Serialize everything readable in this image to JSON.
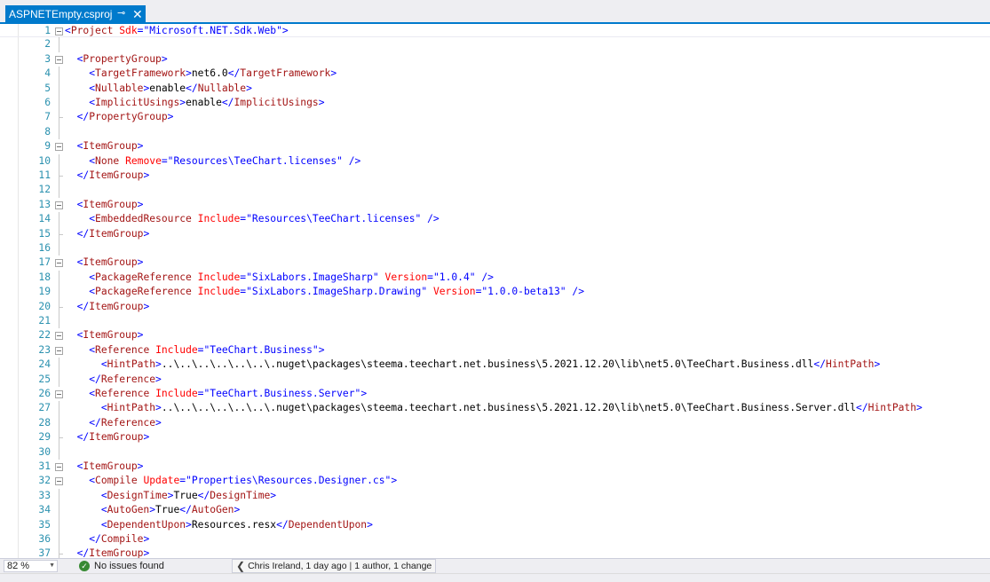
{
  "tab": {
    "title": "ASPNETEmpty.csproj",
    "pin_glyph": "⊸",
    "close_glyph": "✕"
  },
  "editor": {
    "lines": [
      {
        "n": "1",
        "tokens": [
          [
            "d",
            "<"
          ],
          [
            "e",
            "Project"
          ],
          [
            "x",
            " "
          ],
          [
            "a",
            "Sdk"
          ],
          [
            "d",
            "=\""
          ],
          [
            "v",
            "Microsoft.NET.Sdk.Web"
          ],
          [
            "d",
            "\">"
          ]
        ]
      },
      {
        "n": "2",
        "tokens": []
      },
      {
        "n": "3",
        "tokens": [
          [
            "x",
            "  "
          ],
          [
            "d",
            "<"
          ],
          [
            "e",
            "PropertyGroup"
          ],
          [
            "d",
            ">"
          ]
        ]
      },
      {
        "n": "4",
        "tokens": [
          [
            "x",
            "    "
          ],
          [
            "d",
            "<"
          ],
          [
            "e",
            "TargetFramework"
          ],
          [
            "d",
            ">"
          ],
          [
            "x",
            "net6.0"
          ],
          [
            "d",
            "</"
          ],
          [
            "e",
            "TargetFramework"
          ],
          [
            "d",
            ">"
          ]
        ]
      },
      {
        "n": "5",
        "tokens": [
          [
            "x",
            "    "
          ],
          [
            "d",
            "<"
          ],
          [
            "e",
            "Nullable"
          ],
          [
            "d",
            ">"
          ],
          [
            "x",
            "enable"
          ],
          [
            "d",
            "</"
          ],
          [
            "e",
            "Nullable"
          ],
          [
            "d",
            ">"
          ]
        ]
      },
      {
        "n": "6",
        "tokens": [
          [
            "x",
            "    "
          ],
          [
            "d",
            "<"
          ],
          [
            "e",
            "ImplicitUsings"
          ],
          [
            "d",
            ">"
          ],
          [
            "x",
            "enable"
          ],
          [
            "d",
            "</"
          ],
          [
            "e",
            "ImplicitUsings"
          ],
          [
            "d",
            ">"
          ]
        ]
      },
      {
        "n": "7",
        "tokens": [
          [
            "x",
            "  "
          ],
          [
            "d",
            "</"
          ],
          [
            "e",
            "PropertyGroup"
          ],
          [
            "d",
            ">"
          ]
        ]
      },
      {
        "n": "8",
        "tokens": []
      },
      {
        "n": "9",
        "tokens": [
          [
            "x",
            "  "
          ],
          [
            "d",
            "<"
          ],
          [
            "e",
            "ItemGroup"
          ],
          [
            "d",
            ">"
          ]
        ]
      },
      {
        "n": "10",
        "tokens": [
          [
            "x",
            "    "
          ],
          [
            "d",
            "<"
          ],
          [
            "e",
            "None"
          ],
          [
            "x",
            " "
          ],
          [
            "a",
            "Remove"
          ],
          [
            "d",
            "=\""
          ],
          [
            "v",
            "Resources\\TeeChart.licenses"
          ],
          [
            "d",
            "\" />"
          ]
        ]
      },
      {
        "n": "11",
        "tokens": [
          [
            "x",
            "  "
          ],
          [
            "d",
            "</"
          ],
          [
            "e",
            "ItemGroup"
          ],
          [
            "d",
            ">"
          ]
        ]
      },
      {
        "n": "12",
        "tokens": []
      },
      {
        "n": "13",
        "tokens": [
          [
            "x",
            "  "
          ],
          [
            "d",
            "<"
          ],
          [
            "e",
            "ItemGroup"
          ],
          [
            "d",
            ">"
          ]
        ]
      },
      {
        "n": "14",
        "tokens": [
          [
            "x",
            "    "
          ],
          [
            "d",
            "<"
          ],
          [
            "e",
            "EmbeddedResource"
          ],
          [
            "x",
            " "
          ],
          [
            "a",
            "Include"
          ],
          [
            "d",
            "=\""
          ],
          [
            "v",
            "Resources\\TeeChart.licenses"
          ],
          [
            "d",
            "\" />"
          ]
        ]
      },
      {
        "n": "15",
        "tokens": [
          [
            "x",
            "  "
          ],
          [
            "d",
            "</"
          ],
          [
            "e",
            "ItemGroup"
          ],
          [
            "d",
            ">"
          ]
        ]
      },
      {
        "n": "16",
        "tokens": []
      },
      {
        "n": "17",
        "tokens": [
          [
            "x",
            "  "
          ],
          [
            "d",
            "<"
          ],
          [
            "e",
            "ItemGroup"
          ],
          [
            "d",
            ">"
          ]
        ]
      },
      {
        "n": "18",
        "tokens": [
          [
            "x",
            "    "
          ],
          [
            "d",
            "<"
          ],
          [
            "e",
            "PackageReference"
          ],
          [
            "x",
            " "
          ],
          [
            "a",
            "Include"
          ],
          [
            "d",
            "=\""
          ],
          [
            "v",
            "SixLabors.ImageSharp"
          ],
          [
            "d",
            "\""
          ],
          [
            "x",
            " "
          ],
          [
            "a",
            "Version"
          ],
          [
            "d",
            "=\""
          ],
          [
            "v",
            "1.0.4"
          ],
          [
            "d",
            "\" />"
          ]
        ]
      },
      {
        "n": "19",
        "tokens": [
          [
            "x",
            "    "
          ],
          [
            "d",
            "<"
          ],
          [
            "e",
            "PackageReference"
          ],
          [
            "x",
            " "
          ],
          [
            "a",
            "Include"
          ],
          [
            "d",
            "=\""
          ],
          [
            "v",
            "SixLabors.ImageSharp.Drawing"
          ],
          [
            "d",
            "\""
          ],
          [
            "x",
            " "
          ],
          [
            "a",
            "Version"
          ],
          [
            "d",
            "=\""
          ],
          [
            "v",
            "1.0.0-beta13"
          ],
          [
            "d",
            "\" />"
          ]
        ]
      },
      {
        "n": "20",
        "tokens": [
          [
            "x",
            "  "
          ],
          [
            "d",
            "</"
          ],
          [
            "e",
            "ItemGroup"
          ],
          [
            "d",
            ">"
          ]
        ]
      },
      {
        "n": "21",
        "tokens": []
      },
      {
        "n": "22",
        "tokens": [
          [
            "x",
            "  "
          ],
          [
            "d",
            "<"
          ],
          [
            "e",
            "ItemGroup"
          ],
          [
            "d",
            ">"
          ]
        ]
      },
      {
        "n": "23",
        "tokens": [
          [
            "x",
            "    "
          ],
          [
            "d",
            "<"
          ],
          [
            "e",
            "Reference"
          ],
          [
            "x",
            " "
          ],
          [
            "a",
            "Include"
          ],
          [
            "d",
            "=\""
          ],
          [
            "v",
            "TeeChart.Business"
          ],
          [
            "d",
            "\">"
          ]
        ]
      },
      {
        "n": "24",
        "tokens": [
          [
            "x",
            "      "
          ],
          [
            "d",
            "<"
          ],
          [
            "e",
            "HintPath"
          ],
          [
            "d",
            ">"
          ],
          [
            "x",
            "..\\..\\..\\..\\..\\..\\.nuget\\packages\\steema.teechart.net.business\\5.2021.12.20\\lib\\net5.0\\TeeChart.Business.dll"
          ],
          [
            "d",
            "</"
          ],
          [
            "e",
            "HintPath"
          ],
          [
            "d",
            ">"
          ]
        ]
      },
      {
        "n": "25",
        "tokens": [
          [
            "x",
            "    "
          ],
          [
            "d",
            "</"
          ],
          [
            "e",
            "Reference"
          ],
          [
            "d",
            ">"
          ]
        ]
      },
      {
        "n": "26",
        "tokens": [
          [
            "x",
            "    "
          ],
          [
            "d",
            "<"
          ],
          [
            "e",
            "Reference"
          ],
          [
            "x",
            " "
          ],
          [
            "a",
            "Include"
          ],
          [
            "d",
            "=\""
          ],
          [
            "v",
            "TeeChart.Business.Server"
          ],
          [
            "d",
            "\">"
          ]
        ]
      },
      {
        "n": "27",
        "tokens": [
          [
            "x",
            "      "
          ],
          [
            "d",
            "<"
          ],
          [
            "e",
            "HintPath"
          ],
          [
            "d",
            ">"
          ],
          [
            "x",
            "..\\..\\..\\..\\..\\..\\.nuget\\packages\\steema.teechart.net.business\\5.2021.12.20\\lib\\net5.0\\TeeChart.Business.Server.dll"
          ],
          [
            "d",
            "</"
          ],
          [
            "e",
            "HintPath"
          ],
          [
            "d",
            ">"
          ]
        ]
      },
      {
        "n": "28",
        "tokens": [
          [
            "x",
            "    "
          ],
          [
            "d",
            "</"
          ],
          [
            "e",
            "Reference"
          ],
          [
            "d",
            ">"
          ]
        ]
      },
      {
        "n": "29",
        "tokens": [
          [
            "x",
            "  "
          ],
          [
            "d",
            "</"
          ],
          [
            "e",
            "ItemGroup"
          ],
          [
            "d",
            ">"
          ]
        ]
      },
      {
        "n": "30",
        "tokens": []
      },
      {
        "n": "31",
        "tokens": [
          [
            "x",
            "  "
          ],
          [
            "d",
            "<"
          ],
          [
            "e",
            "ItemGroup"
          ],
          [
            "d",
            ">"
          ]
        ]
      },
      {
        "n": "32",
        "tokens": [
          [
            "x",
            "    "
          ],
          [
            "d",
            "<"
          ],
          [
            "e",
            "Compile"
          ],
          [
            "x",
            " "
          ],
          [
            "a",
            "Update"
          ],
          [
            "d",
            "=\""
          ],
          [
            "v",
            "Properties\\Resources.Designer.cs"
          ],
          [
            "d",
            "\">"
          ]
        ]
      },
      {
        "n": "33",
        "tokens": [
          [
            "x",
            "      "
          ],
          [
            "d",
            "<"
          ],
          [
            "e",
            "DesignTime"
          ],
          [
            "d",
            ">"
          ],
          [
            "x",
            "True"
          ],
          [
            "d",
            "</"
          ],
          [
            "e",
            "DesignTime"
          ],
          [
            "d",
            ">"
          ]
        ]
      },
      {
        "n": "34",
        "tokens": [
          [
            "x",
            "      "
          ],
          [
            "d",
            "<"
          ],
          [
            "e",
            "AutoGen"
          ],
          [
            "d",
            ">"
          ],
          [
            "x",
            "True"
          ],
          [
            "d",
            "</"
          ],
          [
            "e",
            "AutoGen"
          ],
          [
            "d",
            ">"
          ]
        ]
      },
      {
        "n": "35",
        "tokens": [
          [
            "x",
            "      "
          ],
          [
            "d",
            "<"
          ],
          [
            "e",
            "DependentUpon"
          ],
          [
            "d",
            ">"
          ],
          [
            "x",
            "Resources.resx"
          ],
          [
            "d",
            "</"
          ],
          [
            "e",
            "DependentUpon"
          ],
          [
            "d",
            ">"
          ]
        ]
      },
      {
        "n": "36",
        "tokens": [
          [
            "x",
            "    "
          ],
          [
            "d",
            "</"
          ],
          [
            "e",
            "Compile"
          ],
          [
            "d",
            ">"
          ]
        ]
      },
      {
        "n": "37",
        "tokens": [
          [
            "x",
            "  "
          ],
          [
            "d",
            "</"
          ],
          [
            "e",
            "ItemGroup"
          ],
          [
            "d",
            ">"
          ]
        ]
      }
    ],
    "fold_lines": [
      "1",
      "3",
      "9",
      "13",
      "17",
      "22",
      "23",
      "26",
      "31",
      "32"
    ],
    "colors": {
      "delimiter": "#0000ff",
      "element": "#a31515",
      "attribute": "#ff0000",
      "value": "#0000ff",
      "line_number": "#2b91af",
      "accent": "#007acc"
    }
  },
  "status": {
    "zoom": "82 %",
    "issues": "No issues found",
    "issues_icon": "✓",
    "blame_author": "Chris Ireland, 1 day ago",
    "blame_separator": "|",
    "blame_summary": "1 author, 1 change"
  }
}
